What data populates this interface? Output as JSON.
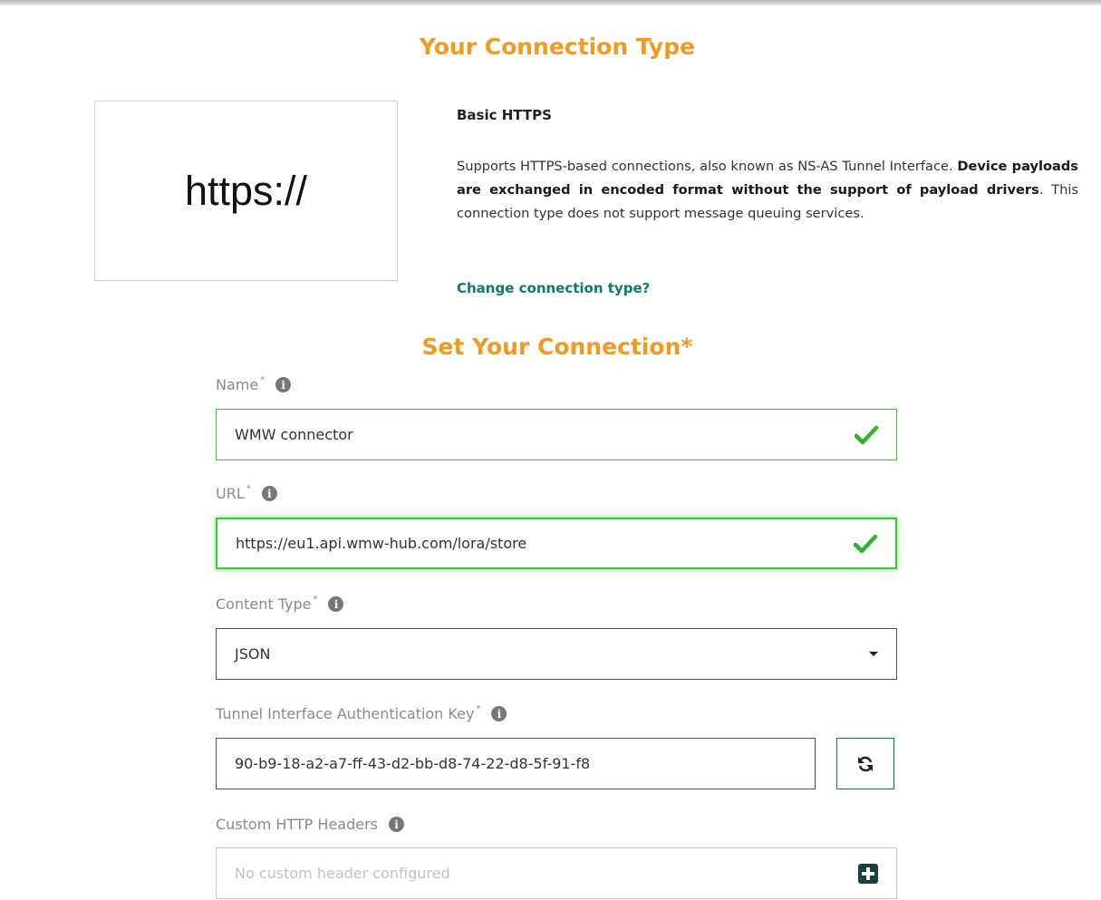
{
  "header": {
    "connection_type_title": "Your Connection Type",
    "set_connection_title": "Set Your Connection*"
  },
  "connection_type": {
    "card_text": "https://",
    "name": "Basic HTTPS",
    "description_plain_1": "Supports HTTPS-based connections, also known as NS-AS Tunnel Interface. ",
    "description_bold": "Device payloads are exchanged in encoded format without the support of payload drivers",
    "description_plain_2": ". This connection type does not support message queuing services.",
    "change_link": "Change connection type?"
  },
  "form": {
    "name": {
      "label": "Name",
      "required_mark": "*",
      "value": "WMW connector"
    },
    "url": {
      "label": "URL",
      "required_mark": "*",
      "value": "https://eu1.api.wmw-hub.com/lora/store"
    },
    "content_type": {
      "label": "Content Type",
      "required_mark": "*",
      "selected": "JSON"
    },
    "auth_key": {
      "label": "Tunnel Interface Authentication Key",
      "required_mark": "*",
      "value": "90-b9-18-a2-a7-ff-43-d2-bb-d8-74-22-d8-5f-91-f8"
    },
    "custom_headers": {
      "label": "Custom HTTP Headers",
      "placeholder": "No custom header configured"
    }
  },
  "icons": {
    "info": "info-icon",
    "valid": "check-icon",
    "dropdown": "caret-down-icon",
    "regenerate": "refresh-icon",
    "add": "plus-square-icon"
  },
  "colors": {
    "accent_orange": "#f39a1e",
    "link_teal": "#0b7a75",
    "valid_green": "#2ed12e"
  }
}
